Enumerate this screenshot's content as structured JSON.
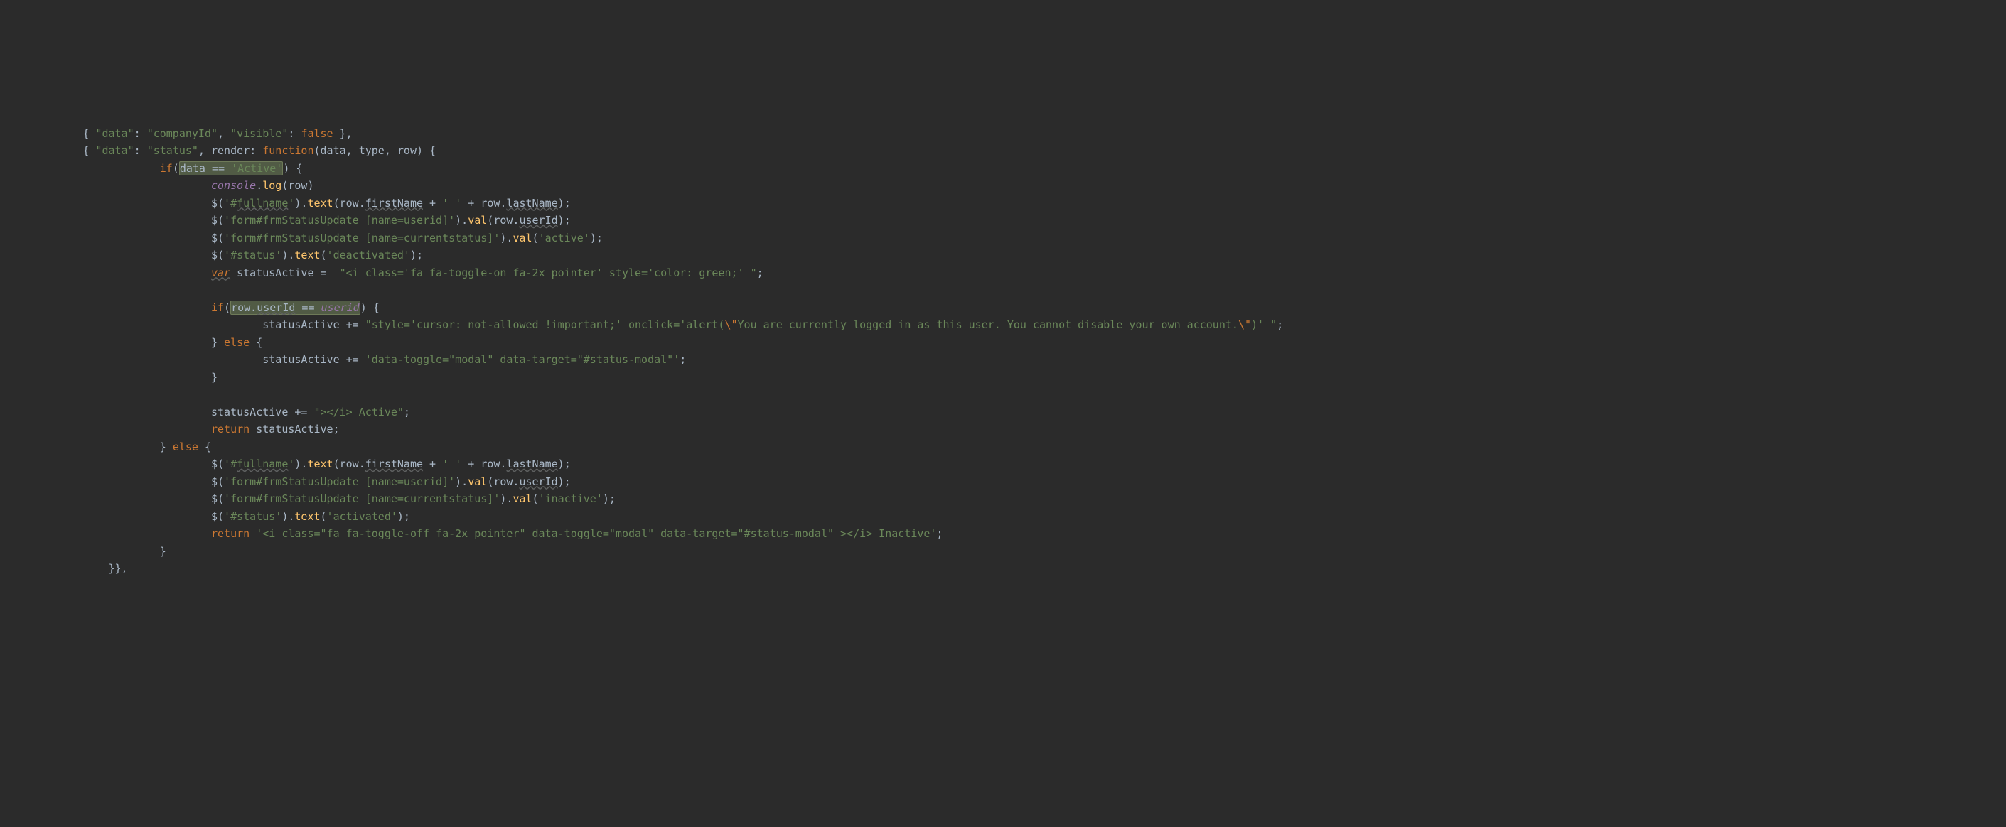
{
  "lines": [
    {
      "indent": 3,
      "tokens": [
        {
          "t": "{ ",
          "c": "t-punct"
        },
        {
          "t": "\"data\"",
          "c": "t-key"
        },
        {
          "t": ": ",
          "c": "t-punct"
        },
        {
          "t": "\"companyId\"",
          "c": "t-string"
        },
        {
          "t": ", ",
          "c": "t-punct"
        },
        {
          "t": "\"visible\"",
          "c": "t-key"
        },
        {
          "t": ": ",
          "c": "t-punct"
        },
        {
          "t": "false",
          "c": "t-bool"
        },
        {
          "t": " },",
          "c": "t-punct"
        }
      ]
    },
    {
      "indent": 3,
      "tokens": [
        {
          "t": "{ ",
          "c": "t-punct"
        },
        {
          "t": "\"data\"",
          "c": "t-key"
        },
        {
          "t": ": ",
          "c": "t-punct"
        },
        {
          "t": "\"status\"",
          "c": "t-string"
        },
        {
          "t": ", ",
          "c": "t-punct"
        },
        {
          "t": "render",
          "c": "t-ident"
        },
        {
          "t": ": ",
          "c": "t-punct"
        },
        {
          "t": "function",
          "c": "t-keyword"
        },
        {
          "t": "(",
          "c": "t-punct"
        },
        {
          "t": "data",
          "c": "t-param"
        },
        {
          "t": ", ",
          "c": "t-punct"
        },
        {
          "t": "type",
          "c": "t-param"
        },
        {
          "t": ", ",
          "c": "t-punct"
        },
        {
          "t": "row",
          "c": "t-param"
        },
        {
          "t": ") {",
          "c": "t-punct"
        }
      ]
    },
    {
      "indent": 6,
      "tokens": [
        {
          "t": "if",
          "c": "t-keyword"
        },
        {
          "t": "(",
          "c": "t-punct"
        },
        {
          "t": "data == ",
          "c": "t-ident",
          "hl": true
        },
        {
          "t": "'Active'",
          "c": "t-string",
          "hl": true
        },
        {
          "t": ") {",
          "c": "t-punct"
        }
      ]
    },
    {
      "indent": 8,
      "tokens": [
        {
          "t": "console",
          "c": "t-console"
        },
        {
          "t": ".",
          "c": "t-punct"
        },
        {
          "t": "log",
          "c": "t-method"
        },
        {
          "t": "(row)",
          "c": "t-punct"
        }
      ]
    },
    {
      "indent": 8,
      "tokens": [
        {
          "t": "$",
          "c": "t-ident"
        },
        {
          "t": "(",
          "c": "t-punct"
        },
        {
          "t": "'#",
          "c": "t-string"
        },
        {
          "t": "fullname",
          "c": "t-string underline-wave"
        },
        {
          "t": "'",
          "c": "t-string"
        },
        {
          "t": ").",
          "c": "t-punct"
        },
        {
          "t": "text",
          "c": "t-method"
        },
        {
          "t": "(row.",
          "c": "t-punct"
        },
        {
          "t": "firstName",
          "c": "t-ident underline-wave"
        },
        {
          "t": " + ",
          "c": "t-punct"
        },
        {
          "t": "' '",
          "c": "t-string"
        },
        {
          "t": " + row.",
          "c": "t-punct"
        },
        {
          "t": "lastName",
          "c": "t-ident underline-wave"
        },
        {
          "t": ");",
          "c": "t-punct"
        }
      ]
    },
    {
      "indent": 8,
      "tokens": [
        {
          "t": "$",
          "c": "t-ident"
        },
        {
          "t": "(",
          "c": "t-punct"
        },
        {
          "t": "'form#frmStatusUpdate [name=userid]'",
          "c": "t-string"
        },
        {
          "t": ").",
          "c": "t-punct"
        },
        {
          "t": "val",
          "c": "t-method"
        },
        {
          "t": "(row.",
          "c": "t-punct"
        },
        {
          "t": "userId",
          "c": "t-ident underline-wave"
        },
        {
          "t": ");",
          "c": "t-punct"
        }
      ]
    },
    {
      "indent": 8,
      "tokens": [
        {
          "t": "$",
          "c": "t-ident"
        },
        {
          "t": "(",
          "c": "t-punct"
        },
        {
          "t": "'form#frmStatusUpdate [name=currentstatus]'",
          "c": "t-string"
        },
        {
          "t": ").",
          "c": "t-punct"
        },
        {
          "t": "val",
          "c": "t-method"
        },
        {
          "t": "(",
          "c": "t-punct"
        },
        {
          "t": "'active'",
          "c": "t-string"
        },
        {
          "t": ");",
          "c": "t-punct"
        }
      ]
    },
    {
      "indent": 8,
      "tokens": [
        {
          "t": "$",
          "c": "t-ident"
        },
        {
          "t": "(",
          "c": "t-punct"
        },
        {
          "t": "'#status'",
          "c": "t-string"
        },
        {
          "t": ").",
          "c": "t-punct"
        },
        {
          "t": "text",
          "c": "t-method"
        },
        {
          "t": "(",
          "c": "t-punct"
        },
        {
          "t": "'deactivated'",
          "c": "t-string"
        },
        {
          "t": ");",
          "c": "t-punct"
        }
      ]
    },
    {
      "indent": 8,
      "tokens": [
        {
          "t": "var",
          "c": "t-var underline-wave"
        },
        {
          "t": " statusActive =  ",
          "c": "t-ident"
        },
        {
          "t": "\"<i class='fa fa-toggle-on fa-2x pointer' style='color: green;' \"",
          "c": "t-string"
        },
        {
          "t": ";",
          "c": "t-punct"
        }
      ]
    },
    {
      "indent": 8,
      "tokens": []
    },
    {
      "indent": 8,
      "tokens": [
        {
          "t": "if",
          "c": "t-keyword"
        },
        {
          "t": "(",
          "c": "t-punct"
        },
        {
          "t": "row.",
          "c": "t-ident",
          "hl": true
        },
        {
          "t": "userId",
          "c": "t-ident underline-wave",
          "hl": true
        },
        {
          "t": " == ",
          "c": "t-ident",
          "hl": true
        },
        {
          "t": "userid",
          "c": "t-usage",
          "hl": true
        },
        {
          "t": ") {",
          "c": "t-punct"
        }
      ]
    },
    {
      "indent": 10,
      "tokens": [
        {
          "t": "statusActive += ",
          "c": "t-ident"
        },
        {
          "t": "\"style='cursor: not-allowed !important;' onclick='alert(",
          "c": "t-string"
        },
        {
          "t": "\\\"",
          "c": "t-keyword"
        },
        {
          "t": "You are currently logged in as this user. You cannot disable your own account.",
          "c": "t-string"
        },
        {
          "t": "\\\"",
          "c": "t-keyword"
        },
        {
          "t": ")' \"",
          "c": "t-string"
        },
        {
          "t": ";",
          "c": "t-punct"
        }
      ]
    },
    {
      "indent": 8,
      "tokens": [
        {
          "t": "} ",
          "c": "t-punct"
        },
        {
          "t": "else",
          "c": "t-keyword"
        },
        {
          "t": " {",
          "c": "t-punct"
        }
      ]
    },
    {
      "indent": 10,
      "tokens": [
        {
          "t": "statusActive += ",
          "c": "t-ident"
        },
        {
          "t": "'data-toggle=\"modal\" data-target=\"#status-modal\"'",
          "c": "t-string"
        },
        {
          "t": ";",
          "c": "t-punct"
        }
      ]
    },
    {
      "indent": 8,
      "tokens": [
        {
          "t": "}",
          "c": "t-punct"
        }
      ]
    },
    {
      "indent": 8,
      "tokens": []
    },
    {
      "indent": 8,
      "tokens": [
        {
          "t": "statusActive += ",
          "c": "t-ident"
        },
        {
          "t": "\"></i> Active\"",
          "c": "t-string"
        },
        {
          "t": ";",
          "c": "t-punct"
        }
      ]
    },
    {
      "indent": 8,
      "tokens": [
        {
          "t": "return",
          "c": "t-keyword"
        },
        {
          "t": " statusActive;",
          "c": "t-ident"
        }
      ]
    },
    {
      "indent": 6,
      "tokens": [
        {
          "t": "} ",
          "c": "t-punct"
        },
        {
          "t": "else",
          "c": "t-keyword"
        },
        {
          "t": " {",
          "c": "t-punct"
        }
      ]
    },
    {
      "indent": 8,
      "tokens": [
        {
          "t": "$",
          "c": "t-ident"
        },
        {
          "t": "(",
          "c": "t-punct"
        },
        {
          "t": "'#",
          "c": "t-string"
        },
        {
          "t": "fullname",
          "c": "t-string underline-wave"
        },
        {
          "t": "'",
          "c": "t-string"
        },
        {
          "t": ").",
          "c": "t-punct"
        },
        {
          "t": "text",
          "c": "t-method"
        },
        {
          "t": "(row.",
          "c": "t-punct"
        },
        {
          "t": "firstName",
          "c": "t-ident underline-wave"
        },
        {
          "t": " + ",
          "c": "t-punct"
        },
        {
          "t": "' '",
          "c": "t-string"
        },
        {
          "t": " + row.",
          "c": "t-punct"
        },
        {
          "t": "lastName",
          "c": "t-ident underline-wave"
        },
        {
          "t": ");",
          "c": "t-punct"
        }
      ]
    },
    {
      "indent": 8,
      "tokens": [
        {
          "t": "$",
          "c": "t-ident"
        },
        {
          "t": "(",
          "c": "t-punct"
        },
        {
          "t": "'form#frmStatusUpdate [name=userid]'",
          "c": "t-string"
        },
        {
          "t": ").",
          "c": "t-punct"
        },
        {
          "t": "val",
          "c": "t-method"
        },
        {
          "t": "(row.",
          "c": "t-punct"
        },
        {
          "t": "userId",
          "c": "t-ident underline-wave"
        },
        {
          "t": ");",
          "c": "t-punct"
        }
      ]
    },
    {
      "indent": 8,
      "tokens": [
        {
          "t": "$",
          "c": "t-ident"
        },
        {
          "t": "(",
          "c": "t-punct"
        },
        {
          "t": "'form#frmStatusUpdate [name=currentstatus]'",
          "c": "t-string"
        },
        {
          "t": ").",
          "c": "t-punct"
        },
        {
          "t": "val",
          "c": "t-method"
        },
        {
          "t": "(",
          "c": "t-punct"
        },
        {
          "t": "'inactive'",
          "c": "t-string"
        },
        {
          "t": ");",
          "c": "t-punct"
        }
      ]
    },
    {
      "indent": 8,
      "tokens": [
        {
          "t": "$",
          "c": "t-ident"
        },
        {
          "t": "(",
          "c": "t-punct"
        },
        {
          "t": "'#status'",
          "c": "t-string"
        },
        {
          "t": ").",
          "c": "t-punct"
        },
        {
          "t": "text",
          "c": "t-method"
        },
        {
          "t": "(",
          "c": "t-punct"
        },
        {
          "t": "'activated'",
          "c": "t-string"
        },
        {
          "t": ");",
          "c": "t-punct"
        }
      ]
    },
    {
      "indent": 8,
      "tokens": [
        {
          "t": "return",
          "c": "t-keyword"
        },
        {
          "t": " ",
          "c": "t-ident"
        },
        {
          "t": "'<i class=\"fa fa-toggle-off fa-2x pointer\" data-toggle=\"modal\" data-target=\"#status-modal\" ></i> Inactive'",
          "c": "t-string"
        },
        {
          "t": ";",
          "c": "t-punct"
        }
      ]
    },
    {
      "indent": 6,
      "tokens": [
        {
          "t": "}",
          "c": "t-punct"
        }
      ]
    },
    {
      "indent": 4,
      "tokens": [
        {
          "t": "}},",
          "c": "t-punct"
        }
      ]
    }
  ]
}
